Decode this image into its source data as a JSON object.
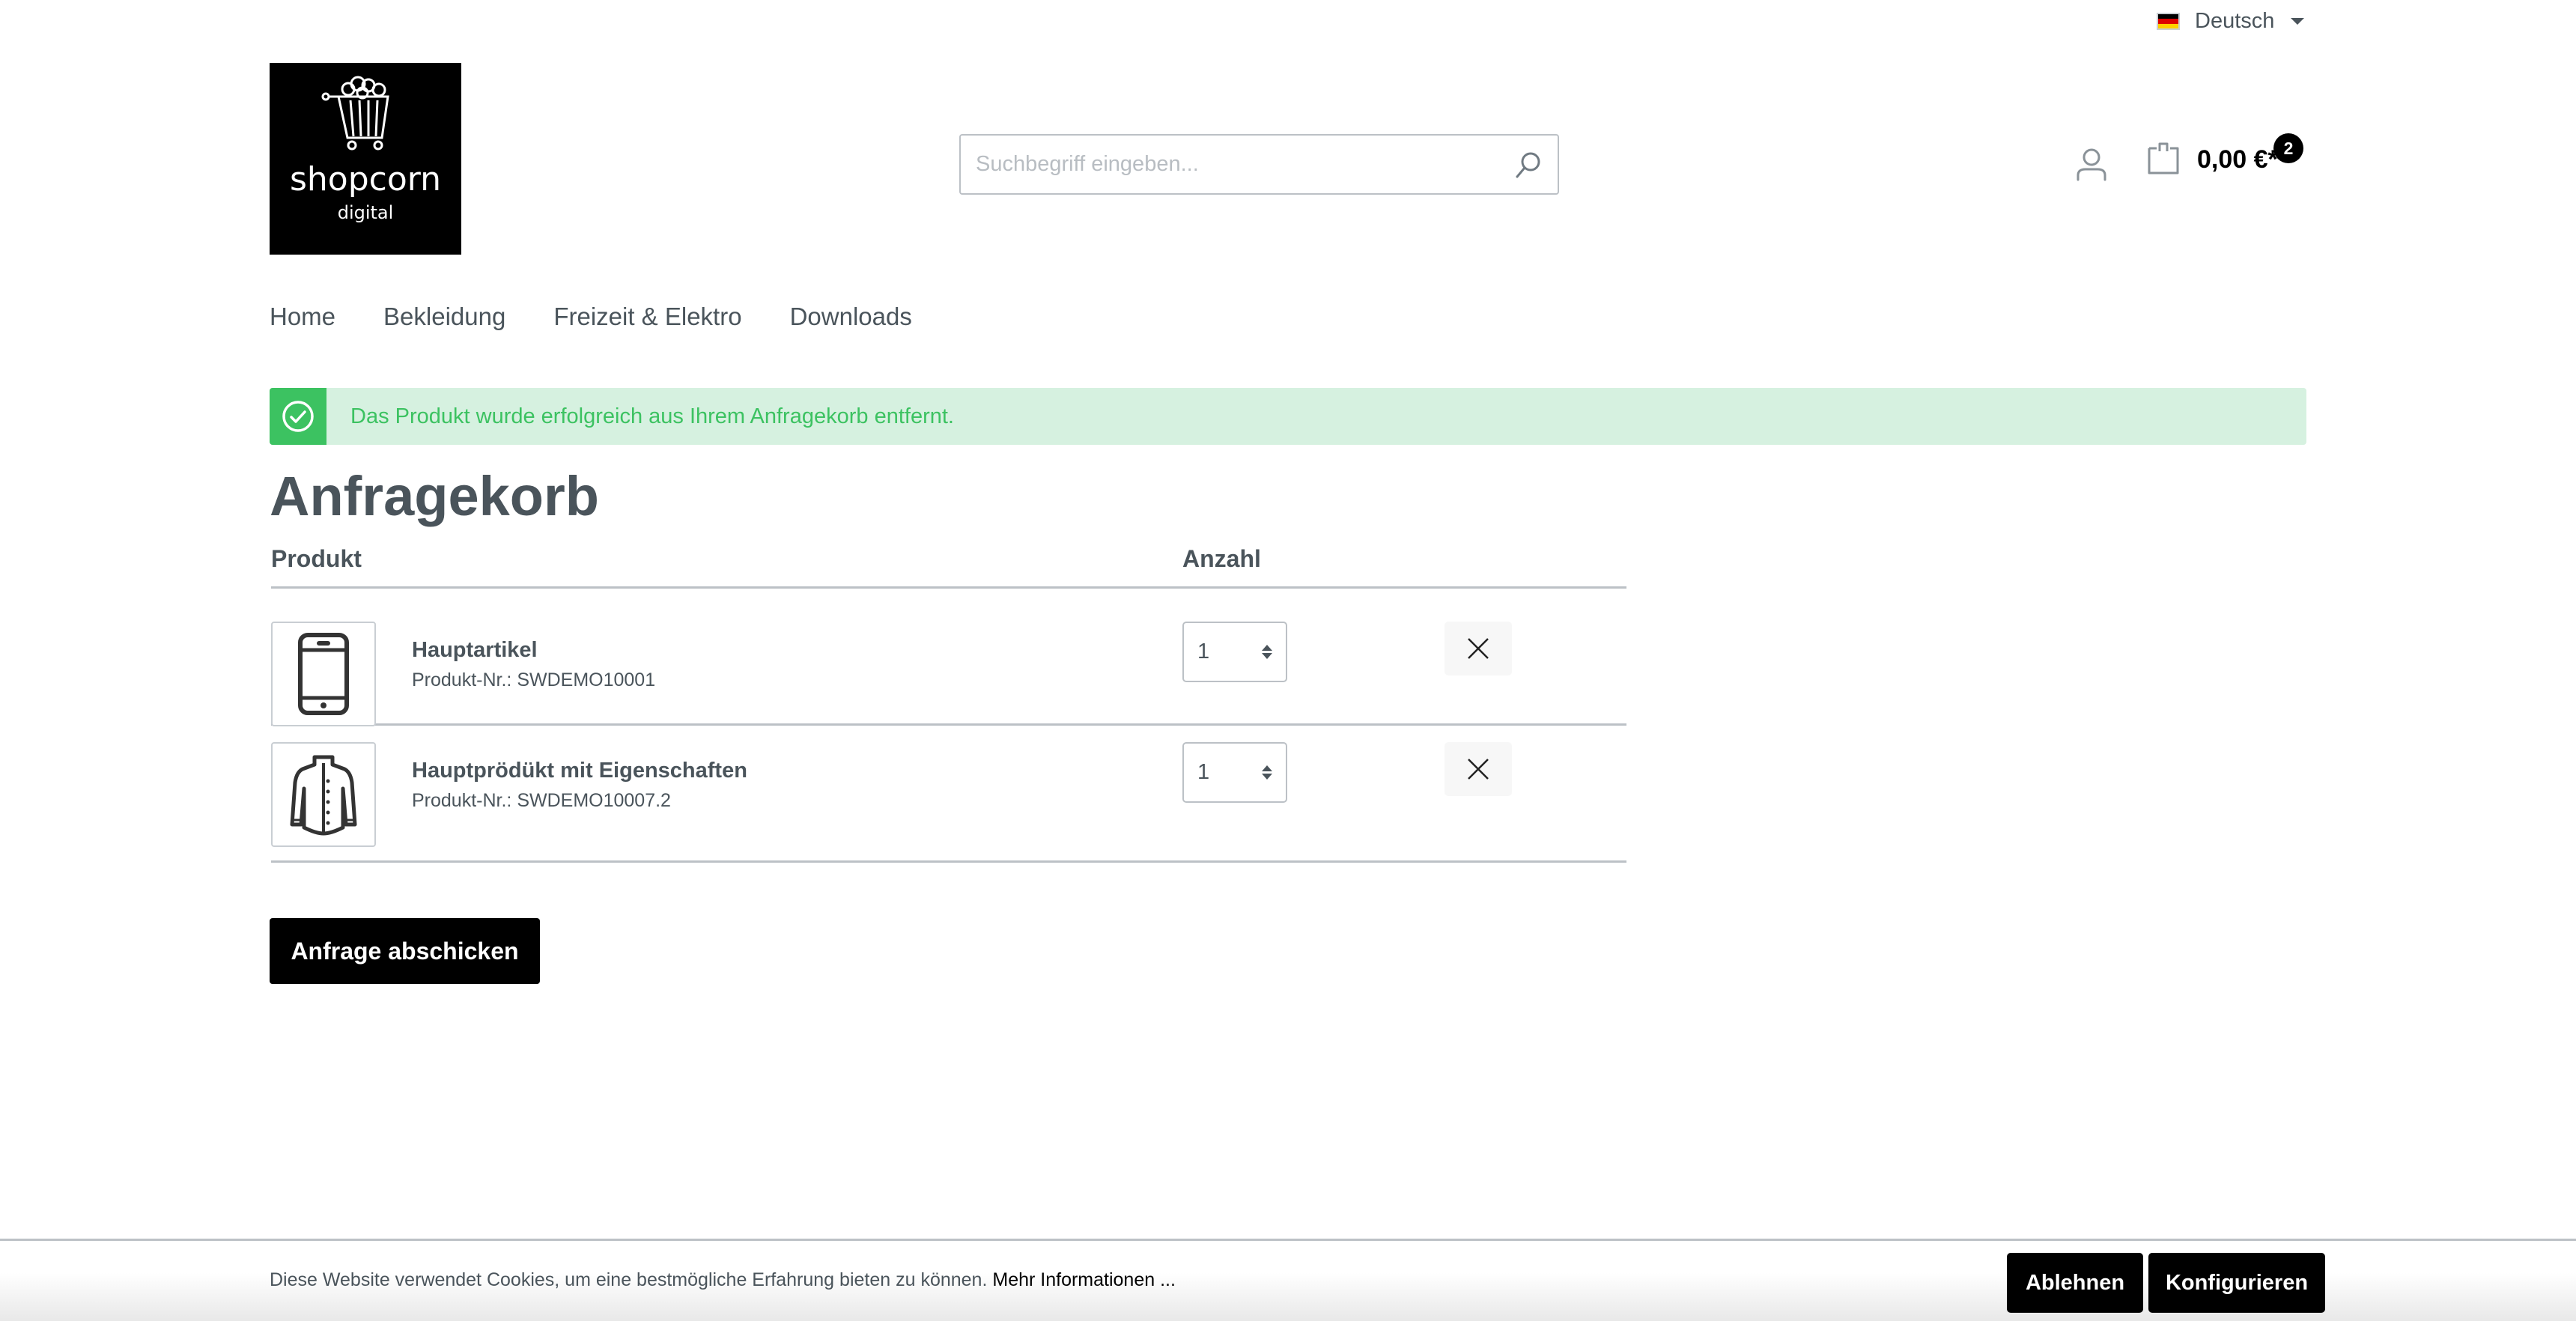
{
  "language": {
    "label": "Deutsch",
    "flag_colors": [
      "#000000",
      "#dd0000",
      "#ffce00"
    ]
  },
  "logo": {
    "brand": "shopcorn",
    "sub": "digital"
  },
  "search": {
    "placeholder": "Suchbegriff eingeben...",
    "value": ""
  },
  "cart": {
    "price": "0,00 €*",
    "count": "2"
  },
  "nav": {
    "items": [
      {
        "label": "Home"
      },
      {
        "label": "Bekleidung"
      },
      {
        "label": "Freizeit & Elektro"
      },
      {
        "label": "Downloads"
      }
    ]
  },
  "alert": {
    "message": "Das Produkt wurde erfolgreich aus Ihrem Anfragekorb entfernt.",
    "type": "success",
    "color": "#3cc261",
    "background": "#d6f1e0"
  },
  "page": {
    "title": "Anfragekorb"
  },
  "table": {
    "headers": {
      "product": "Produkt",
      "quantity": "Anzahl"
    },
    "rows": [
      {
        "name": "Hauptartikel",
        "number": "Produkt-Nr.: SWDEMO10001",
        "quantity": "1",
        "icon": "smartphone-icon"
      },
      {
        "name": "Hauptprödükt mit Eigenschaften",
        "number": "Produkt-Nr.: SWDEMO10007.2",
        "quantity": "1",
        "icon": "jacket-icon"
      }
    ]
  },
  "actions": {
    "submit_label": "Anfrage abschicken"
  },
  "cookie": {
    "text": "Diese Website verwendet Cookies, um eine bestmögliche Erfahrung bieten zu können.",
    "link_label": "Mehr Informationen ...",
    "decline_label": "Ablehnen",
    "configure_label": "Konfigurieren"
  }
}
